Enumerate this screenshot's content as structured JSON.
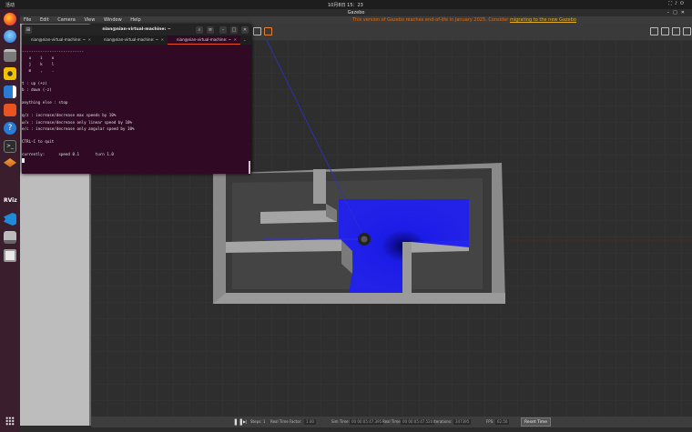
{
  "topbar": {
    "activities": "活动",
    "clock": "10月8日 15：23",
    "tray_icons": [
      "network-icon",
      "volume-icon",
      "power-icon"
    ]
  },
  "dock": {
    "items": [
      "firefox-icon",
      "thunderbird-icon",
      "files-icon",
      "rhythmbox-icon",
      "libreoffice-writer-icon",
      "software-center-icon",
      "help-icon",
      "terminal-icon",
      "layers-icon",
      "rviz-icon",
      "vscode-icon",
      "drive-icon",
      "trash-icon"
    ],
    "rviz_label": "RViz"
  },
  "gazebo": {
    "window_title": "Gazebo",
    "menu": [
      "File",
      "Edit",
      "Camera",
      "View",
      "Window",
      "Help"
    ],
    "deprecation_text": "This version of Gazebo reaches end-of-life in January 2025. Consider",
    "deprecation_link": "migrating to the new Gazebo",
    "status": {
      "steps_label": "Steps:",
      "steps_value": "1",
      "rtf_label": "Real Time Factor:",
      "rtf_value": "1.00",
      "simtime_label": "Sim Time:",
      "simtime_value": "00 00:05:47.395",
      "realtime_label": "Real Time:",
      "realtime_value": "00 00:05:47.520",
      "iterations_label": "Iterations:",
      "iterations_value": "347395",
      "fps_label": "FPS:",
      "fps_value": "62.50",
      "reset_label": "Reset Time"
    }
  },
  "terminal": {
    "title": "nian@nian-virtual-machine: ~",
    "tabs": [
      {
        "label": "nian@nian-virtual-machine: ~"
      },
      {
        "label": "nian@nian-virtual-machine: ~"
      },
      {
        "label": "nian@nian-virtual-machine: ~"
      }
    ],
    "lines": [
      "---------------------------",
      "   u    i    o",
      "   j    k    l",
      "   m    ,    .",
      "",
      "t : up (+z)",
      "b : down (-z)",
      "",
      "anything else : stop",
      "",
      "q/z : increase/decrease max speeds by 10%",
      "w/x : increase/decrease only linear speed by 10%",
      "e/c : increase/decrease only angular speed by 10%",
      "",
      "CTRL-C to quit",
      "",
      "currently:      speed 0.1       turn 1.0"
    ]
  },
  "colors": {
    "terminal_bg": "#300a24",
    "laser_scan": "#1a1af0",
    "deprecation_orange": "#e06a10",
    "ubuntu_orange": "#e95420"
  }
}
